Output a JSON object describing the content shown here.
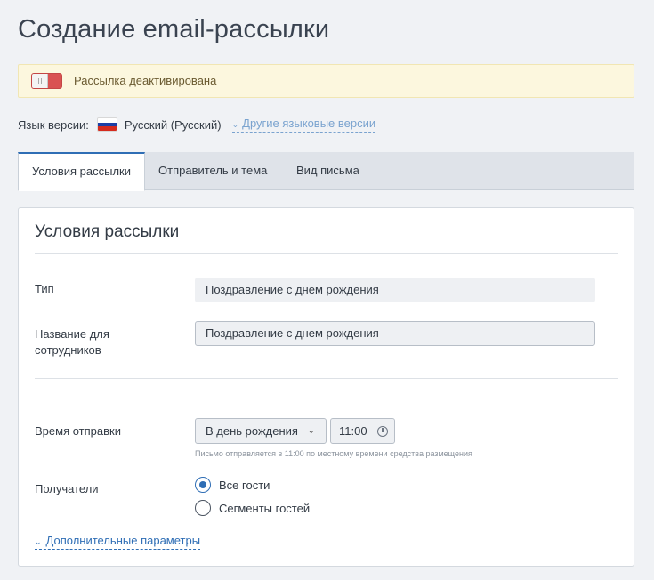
{
  "page": {
    "title": "Создание email-рассылки"
  },
  "status_alert": {
    "text": "Рассылка деактивирована",
    "toggle_state": "off",
    "toggle_color": "#d95252"
  },
  "language": {
    "label": "Язык версии:",
    "flag_icon": "russia-flag-icon",
    "current": "Русский (Русский)",
    "other_link": "Другие языковые версии"
  },
  "tabs": [
    {
      "label": "Условия рассылки",
      "active": true
    },
    {
      "label": "Отправитель и тема",
      "active": false
    },
    {
      "label": "Вид письма",
      "active": false
    }
  ],
  "card": {
    "title": "Условия рассылки",
    "type": {
      "label": "Тип",
      "value": "Поздравление с днем рождения"
    },
    "staff_name": {
      "label": "Название для сотрудников",
      "value": "Поздравление с днем рождения"
    },
    "send_time": {
      "label": "Время отправки",
      "when_selected": "В день рождения",
      "time_value": "11:00",
      "hint": "Письмо отправляется в 11:00 по местному времени средства размещения"
    },
    "recipients": {
      "label": "Получатели",
      "options": [
        {
          "label": "Все гости",
          "checked": true
        },
        {
          "label": "Сегменты гостей",
          "checked": false
        }
      ]
    },
    "advanced_link": "Дополнительные параметры"
  },
  "colors": {
    "accent": "#2f6eb5",
    "alert_bg": "#fcf7de",
    "page_bg": "#f0f2f5"
  }
}
